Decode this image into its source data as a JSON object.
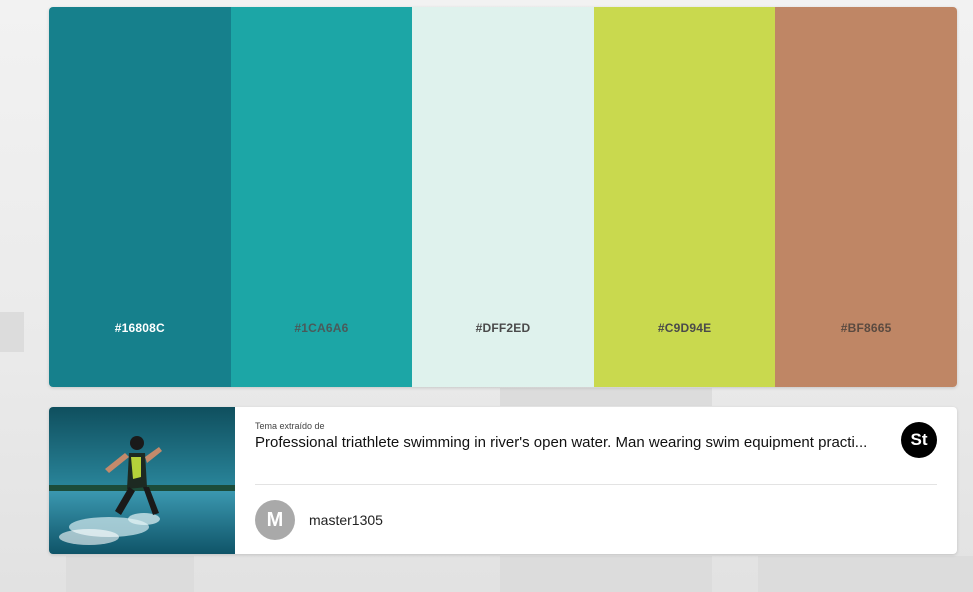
{
  "palette": {
    "swatches": [
      {
        "hex": "#16808C",
        "color": "#16808C",
        "text_color": "#ffffff"
      },
      {
        "hex": "#1CA6A6",
        "color": "#1CA6A6",
        "text_color": "#4a5a5a"
      },
      {
        "hex": "#DFF2ED",
        "color": "#DFF2ED",
        "text_color": "#4a4a4a"
      },
      {
        "hex": "#C9D94E",
        "color": "#C9D94E",
        "text_color": "#4a4a4a"
      },
      {
        "hex": "#BF8665",
        "color": "#BF8665",
        "text_color": "#5a4a40"
      }
    ]
  },
  "source": {
    "label": "Tema extraído de",
    "title": "Professional triathlete swimming in river's open water. Man wearing swim equipment practi...",
    "badge": "St",
    "image_icon": "triathlete-photo"
  },
  "author": {
    "initial": "M",
    "name": "master1305"
  }
}
